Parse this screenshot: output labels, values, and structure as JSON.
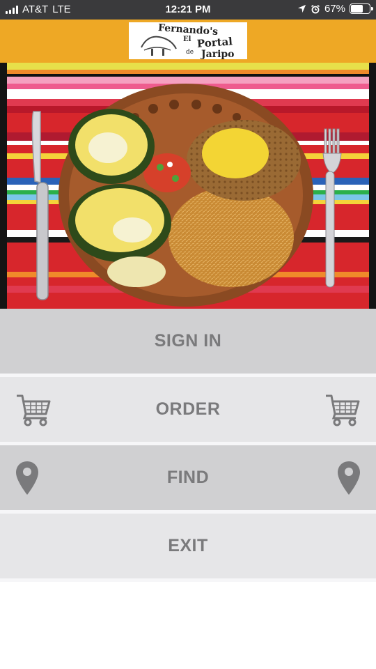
{
  "status_bar": {
    "carrier": "AT&T",
    "network": "LTE",
    "time": "12:21 PM",
    "battery_percent": "67%",
    "battery_level": 0.67,
    "icons": [
      "signal-icon",
      "location-arrow-icon",
      "alarm-icon",
      "battery-icon"
    ]
  },
  "header": {
    "background_color": "#eea825",
    "logo": {
      "line1": "Fernando's",
      "line2": "El",
      "line3": "Portal",
      "line4": "de",
      "line5": "Jaripo"
    }
  },
  "hero_image": {
    "subject": "plate-of-mexican-food"
  },
  "menu": {
    "sign_in": {
      "label": "SIGN IN"
    },
    "order": {
      "label": "ORDER",
      "icon": "shopping-cart-icon"
    },
    "find": {
      "label": "FIND",
      "icon": "map-pin-icon"
    },
    "exit": {
      "label": "EXIT"
    }
  },
  "colors": {
    "button_dark": "#d0d0d2",
    "button_light": "#e6e6e8",
    "button_text": "#7a7a7c",
    "status_bar": "#3a3a3c"
  }
}
